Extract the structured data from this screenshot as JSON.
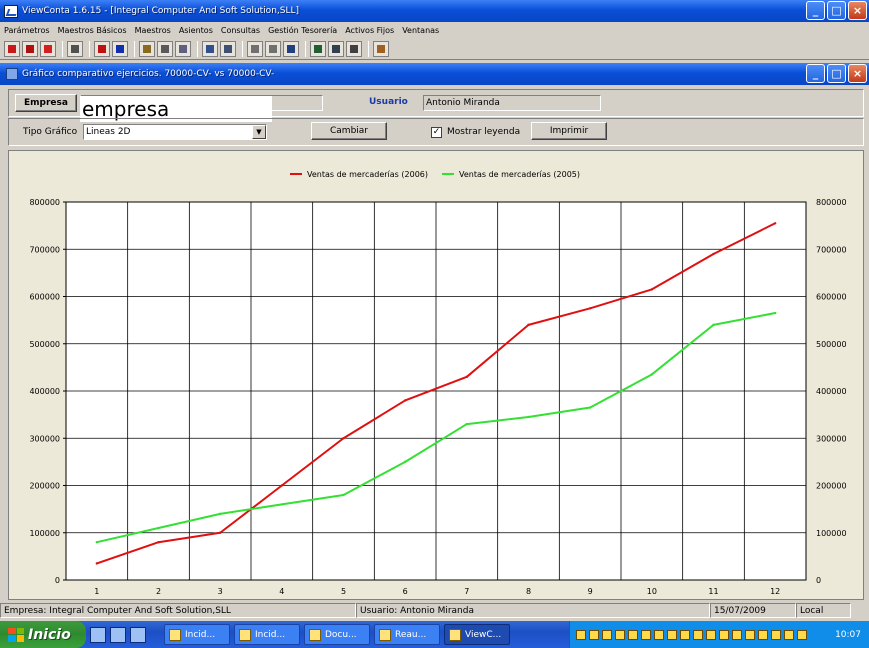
{
  "main_window": {
    "title": "ViewConta 1.6.15 - [Integral Computer And Soft Solution,SLL]",
    "controls": [
      "_",
      "□",
      "×"
    ]
  },
  "menu": [
    "Parámetros",
    "Maestros Básicos",
    "Maestros",
    "Asientos",
    "Consultas",
    "Gestión Tesorería",
    "Activos Fijos",
    "Ventanas"
  ],
  "toolbar": {
    "groups": [
      [
        {
          "icon": "red-flag-icon",
          "color": "#c81818"
        },
        {
          "icon": "red-file-icon",
          "color": "#b01010"
        },
        {
          "icon": "acrobat-icon",
          "color": "#d02020"
        }
      ],
      [
        {
          "icon": "tools-icon",
          "color": "#505050"
        }
      ],
      [
        {
          "icon": "red-book-icon",
          "color": "#c01010"
        },
        {
          "icon": "blue-book-icon",
          "color": "#1030b0"
        }
      ],
      [
        {
          "icon": "chest-icon",
          "color": "#8a6a20"
        },
        {
          "icon": "gears-icon",
          "color": "#5a5a5a"
        },
        {
          "icon": "cart-icon",
          "color": "#606080"
        }
      ],
      [
        {
          "icon": "ledger-icon",
          "color": "#305090"
        },
        {
          "icon": "open-book-icon",
          "color": "#405070"
        }
      ],
      [
        {
          "icon": "cloud-left-icon",
          "color": "#707070"
        },
        {
          "icon": "cloud-right-icon",
          "color": "#707070"
        },
        {
          "icon": "people-icon",
          "color": "#204080"
        }
      ],
      [
        {
          "icon": "tree-icon",
          "color": "#206030"
        },
        {
          "icon": "folder-tree-icon",
          "color": "#304050"
        },
        {
          "icon": "calculator-icon",
          "color": "#404040"
        }
      ],
      [
        {
          "icon": "person-icon",
          "color": "#a06020"
        }
      ]
    ]
  },
  "child_window": {
    "title": "Gráfico comparativo ejercicios. 70000-CV- vs 70000-CV-",
    "controls": [
      "_",
      "□",
      "×"
    ]
  },
  "form": {
    "empresa_button": "Empresa",
    "empresa_overlay": "empresa",
    "usuario_label": "Usuario",
    "usuario_value": "Antonio Miranda",
    "tipo_grafico_label": "Tipo Gráfico",
    "tipo_grafico_value": "Lineas 2D",
    "cambiar_button": "Cambiar",
    "mostrar_leyenda_label": "Mostrar leyenda",
    "mostrar_leyenda_checked": true,
    "imprimir_button": "Imprimir"
  },
  "chart_data": {
    "type": "line",
    "x": [
      1,
      2,
      3,
      4,
      5,
      6,
      7,
      8,
      9,
      10,
      11,
      12
    ],
    "series": [
      {
        "name": "Ventas de mercaderías (2006)",
        "color": "#e01010",
        "values": [
          35000,
          80000,
          100000,
          200000,
          300000,
          380000,
          430000,
          540000,
          575000,
          615000,
          690000,
          755000
        ]
      },
      {
        "name": "Ventas de mercaderías (2005)",
        "color": "#33e033",
        "values": [
          80000,
          110000,
          140000,
          160000,
          180000,
          250000,
          330000,
          345000,
          365000,
          435000,
          540000,
          565000
        ]
      }
    ],
    "yticks": [
      0,
      100000,
      200000,
      300000,
      400000,
      500000,
      600000,
      700000,
      800000
    ],
    "ylim": [
      0,
      800000
    ],
    "grid": true,
    "legend": "top-center",
    "right_axis": true
  },
  "status": {
    "empresa": "Empresa: Integral Computer And Soft Solution,SLL",
    "usuario": "Usuario: Antonio Miranda",
    "fecha": "15/07/2009",
    "modo": "Local"
  },
  "taskbar": {
    "start": "Inicio",
    "tasks": [
      "Incid...",
      "Incid...",
      "Docu...",
      "Reau...",
      "ViewC..."
    ],
    "active_task": 4,
    "clock": "10:07"
  }
}
